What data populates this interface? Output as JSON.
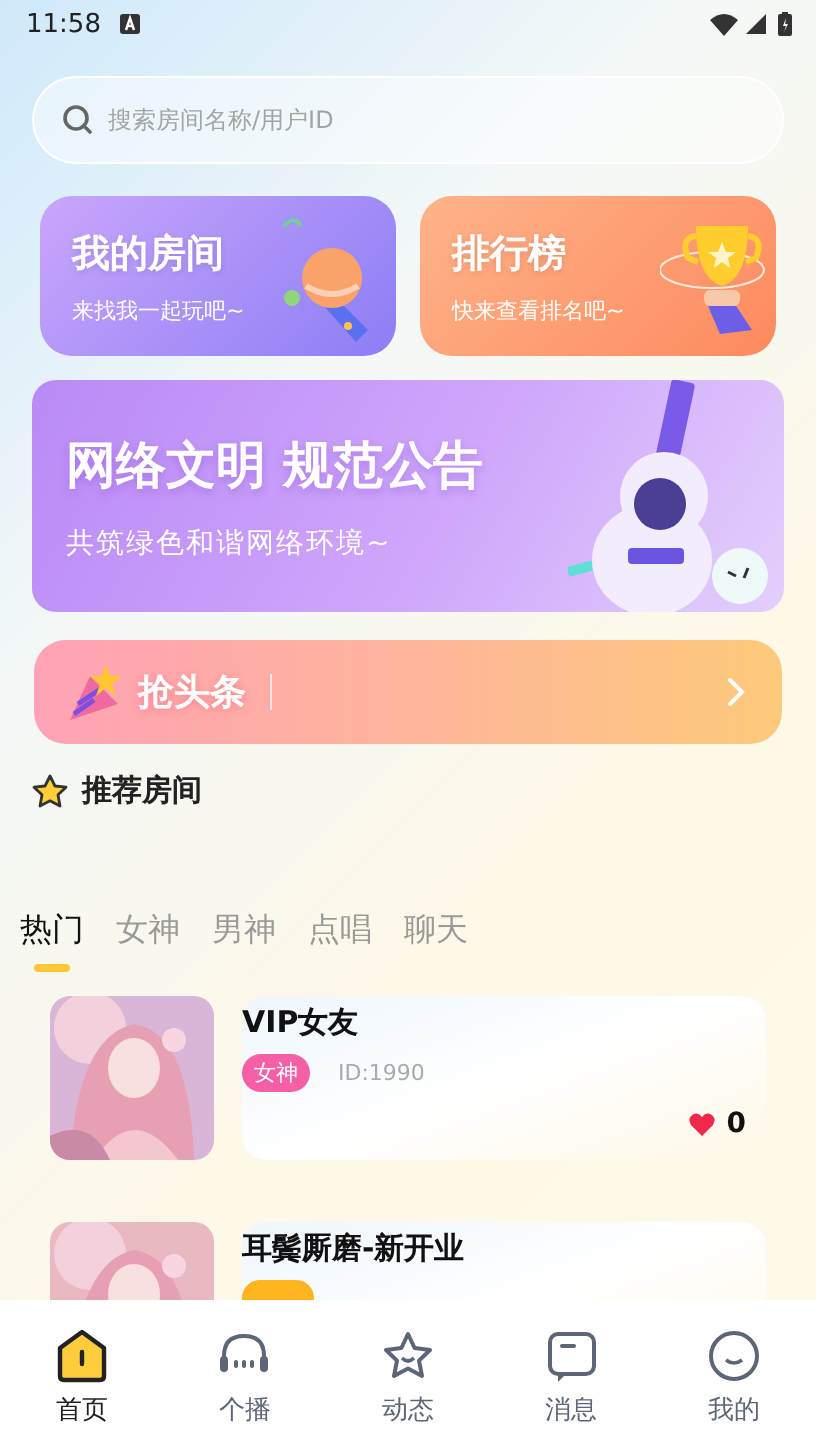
{
  "status_bar": {
    "time": "11:58"
  },
  "search": {
    "placeholder": "搜索房间名称/用户ID"
  },
  "feature_cards": [
    {
      "kind": "rooms",
      "title": "我的房间",
      "subtitle": "来找我一起玩吧~"
    },
    {
      "kind": "ranking",
      "title": "排行榜",
      "subtitle": "快来查看排名吧~"
    }
  ],
  "banner": {
    "title": "网络文明 规范公告",
    "subtitle": "共筑绿色和谐网络环境~"
  },
  "headline": {
    "label": "抢头条"
  },
  "section_title": "推荐房间",
  "tabs": [
    {
      "label": "热门",
      "selected": true
    },
    {
      "label": "女神",
      "selected": false
    },
    {
      "label": "男神",
      "selected": false
    },
    {
      "label": "点唱",
      "selected": false
    },
    {
      "label": "聊天",
      "selected": false
    }
  ],
  "rooms": [
    {
      "name": "VIP女友",
      "tag": "女神",
      "color": "#f45fa5",
      "id": "ID:1990",
      "likes": "0"
    },
    {
      "name": "耳鬓厮磨-新开业",
      "color": "#ffb51e"
    }
  ],
  "nav": [
    {
      "label": "首页",
      "selected": true
    },
    {
      "label": "个播",
      "selected": false
    },
    {
      "label": "动态",
      "selected": false
    },
    {
      "label": "消息",
      "selected": false
    },
    {
      "label": "我的",
      "selected": false
    }
  ]
}
